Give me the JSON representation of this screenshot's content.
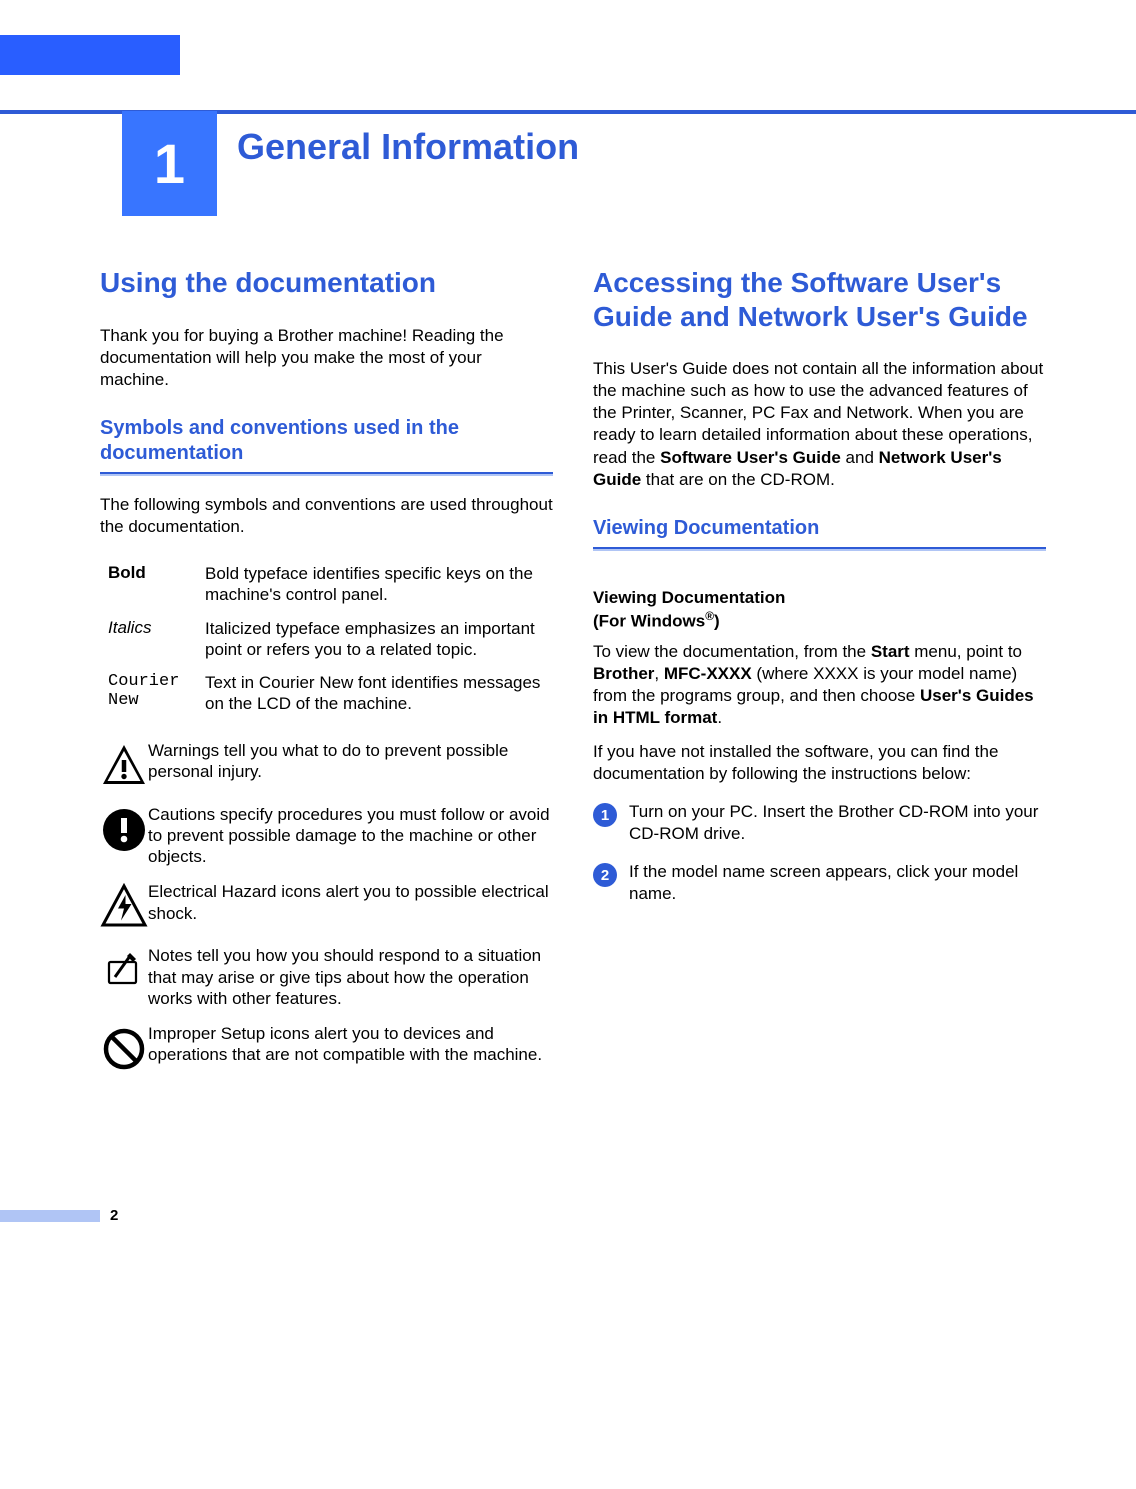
{
  "chapter": {
    "number": "1",
    "title": "General Information"
  },
  "left": {
    "heading": "Using the documentation",
    "intro": "Thank you for buying a Brother machine! Reading the documentation will help you make the most of your machine.",
    "sub1": {
      "title": "Symbols and conventions used in the documentation",
      "intro": "The following symbols and conventions are used throughout the documentation."
    },
    "conventions": [
      {
        "label": "Bold",
        "desc": "Bold typeface identifies specific keys on the machine's control panel."
      },
      {
        "label": "Italics",
        "desc": "Italicized typeface emphasizes an important point or refers you to a related topic."
      },
      {
        "label": "Courier New",
        "desc": "Text in Courier New font identifies messages on the LCD of the machine."
      }
    ],
    "icons": [
      {
        "name": "warning",
        "desc": "Warnings tell you what to do to prevent possible personal injury."
      },
      {
        "name": "caution",
        "desc": "Cautions specify procedures you must follow or avoid to prevent possible damage to the machine or other objects."
      },
      {
        "name": "hazard",
        "desc": "Electrical Hazard icons alert you to possible electrical shock."
      },
      {
        "name": "note",
        "desc": "Notes tell you how you should respond to a situation that may arise or give tips about how the operation works with other features."
      },
      {
        "name": "improper",
        "desc": "Improper Setup icons alert you to devices and operations that are not compatible with the machine."
      }
    ]
  },
  "right": {
    "heading": "Accessing the Software User's Guide and Network User's Guide",
    "intro_parts": {
      "p1": "This User's Guide does not contain all the information about the machine such as how to use the advanced features of the Printer, Scanner, PC Fax and Network. When you are ready to learn detailed information about these operations, read the ",
      "b1": "Software User's Guide",
      "p2": " and ",
      "b2": "Network User's Guide",
      "p3": " that are on the CD-ROM."
    },
    "sub1": {
      "title": "Viewing Documentation"
    },
    "sub2": {
      "title_l1": "Viewing Documentation",
      "title_l2_a": "(For Windows",
      "title_l2_b": ")"
    },
    "view_parts": {
      "p1": "To view the documentation, from the ",
      "b1": "Start",
      "p2": " menu, point to ",
      "b2": "Brother",
      "p3": ", ",
      "b3": "MFC-XXXX",
      "p4": " (where XXXX is your model name) from the programs group, and then choose ",
      "b4": "User's Guides in HTML format",
      "p5": "."
    },
    "not_installed": "If you have not installed the software, you can find the documentation by following the instructions below:",
    "steps": [
      {
        "num": "1",
        "text": "Turn on your PC. Insert the Brother CD-ROM into your CD-ROM drive."
      },
      {
        "num": "2",
        "text": "If the model name screen appears, click your model name."
      }
    ]
  },
  "page_number": "2"
}
